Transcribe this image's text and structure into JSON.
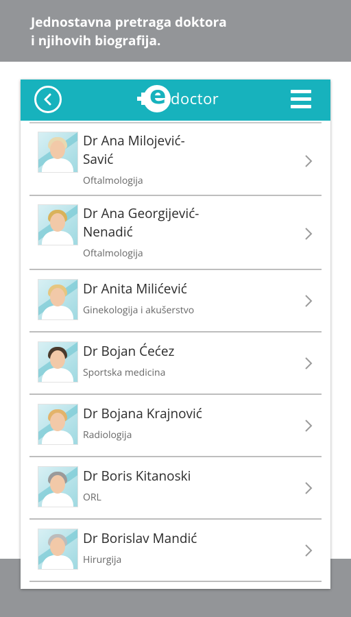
{
  "promo": {
    "line1": "Jednostavna pretraga doktora",
    "line2": "i njihovih biografija."
  },
  "header": {
    "logo_plus": "+",
    "logo_e": "e",
    "logo_text": "doctor",
    "colors": {
      "primary": "#17b2bd",
      "white": "#ffffff"
    }
  },
  "doctors": [
    {
      "name_line1": "Dr Ana Milojević-",
      "name_line2": "Savić",
      "specialty": "Oftalmologija",
      "hair": "#e8d9b0"
    },
    {
      "name_line1": "Dr Ana Georgijević-",
      "name_line2": "Nenadić",
      "specialty": "Oftalmologija",
      "hair": "#d9b25a"
    },
    {
      "name_line1": "Dr Anita Milićević",
      "name_line2": "",
      "specialty": "Ginekologija i akušerstvo",
      "hair": "#e6c680"
    },
    {
      "name_line1": "Dr Bojan Ćećez",
      "name_line2": "",
      "specialty": "Sportska medicina",
      "hair": "#4a3a2c"
    },
    {
      "name_line1": "Dr Bojana Krajnović",
      "name_line2": "",
      "specialty": "Radiologija",
      "hair": "#e3b36a"
    },
    {
      "name_line1": "Dr Boris Kitanoski",
      "name_line2": "",
      "specialty": "ORL",
      "hair": "#9a9a9a"
    },
    {
      "name_line1": "Dr Borislav Mandić",
      "name_line2": "",
      "specialty": "Hirurgija",
      "hair": "#bcbcbc"
    }
  ]
}
